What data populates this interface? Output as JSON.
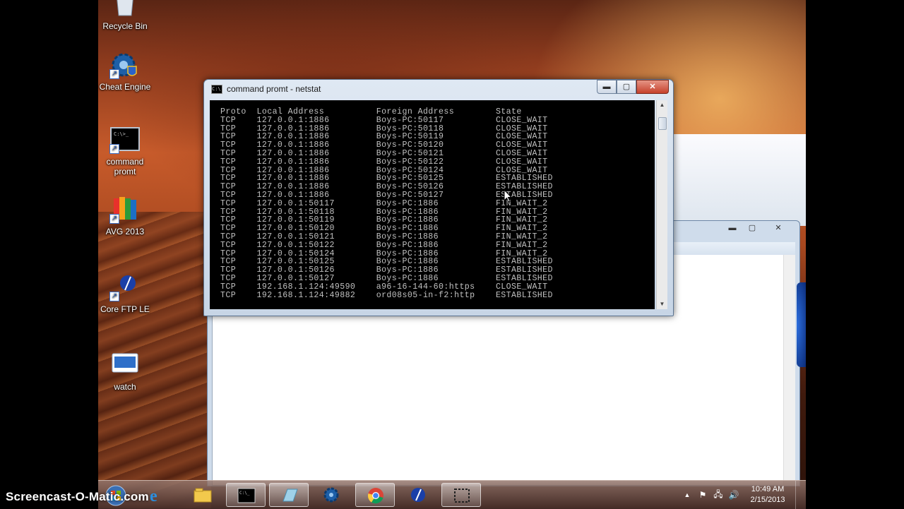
{
  "desktop": {
    "icons": [
      {
        "name": "Recycle Bin"
      },
      {
        "name": "Cheat Engine"
      },
      {
        "name": "command\npromt"
      },
      {
        "name": "AVG 2013"
      },
      {
        "name": "Core FTP LE"
      },
      {
        "name": "watch"
      }
    ]
  },
  "cmd_window": {
    "title": "command promt - netstat",
    "buttons": {
      "minimize": "▬",
      "maximize": "▢",
      "close": "✕"
    },
    "console_header": "Proto  Local Address          Foreign Address        State",
    "console_lines": [
      "TCP    127.0.0.1:1886         Boys-PC:50117          CLOSE_WAIT",
      "TCP    127.0.0.1:1886         Boys-PC:50118          CLOSE_WAIT",
      "TCP    127.0.0.1:1886         Boys-PC:50119          CLOSE_WAIT",
      "TCP    127.0.0.1:1886         Boys-PC:50120          CLOSE_WAIT",
      "TCP    127.0.0.1:1886         Boys-PC:50121          CLOSE_WAIT",
      "TCP    127.0.0.1:1886         Boys-PC:50122          CLOSE_WAIT",
      "TCP    127.0.0.1:1886         Boys-PC:50124          CLOSE_WAIT",
      "TCP    127.0.0.1:1886         Boys-PC:50125          ESTABLISHED",
      "TCP    127.0.0.1:1886         Boys-PC:50126          ESTABLISHED",
      "TCP    127.0.0.1:1886         Boys-PC:50127          ESTABLISHED",
      "TCP    127.0.0.1:50117        Boys-PC:1886           FIN_WAIT_2",
      "TCP    127.0.0.1:50118        Boys-PC:1886           FIN_WAIT_2",
      "TCP    127.0.0.1:50119        Boys-PC:1886           FIN_WAIT_2",
      "TCP    127.0.0.1:50120        Boys-PC:1886           FIN_WAIT_2",
      "TCP    127.0.0.1:50121        Boys-PC:1886           FIN_WAIT_2",
      "TCP    127.0.0.1:50122        Boys-PC:1886           FIN_WAIT_2",
      "TCP    127.0.0.1:50124        Boys-PC:1886           FIN_WAIT_2",
      "TCP    127.0.0.1:50125        Boys-PC:1886           ESTABLISHED",
      "TCP    127.0.0.1:50126        Boys-PC:1886           ESTABLISHED",
      "TCP    127.0.0.1:50127        Boys-PC:1886           ESTABLISHED",
      "TCP    192.168.1.124:49590    a96-16-144-60:https    CLOSE_WAIT",
      "TCP    192.168.1.124:49882    ord08s05-in-f2:http    ESTABLISHED"
    ]
  },
  "background_window": {
    "buttons": {
      "minimize": "▬",
      "maximize": "▢",
      "close": "✕"
    }
  },
  "taskbar": {
    "apps": [
      {
        "icon": "windows-start-icon"
      },
      {
        "icon": "internet-explorer-icon"
      },
      {
        "icon": "windows-explorer-icon"
      },
      {
        "icon": "command-prompt-icon"
      },
      {
        "icon": "notepad-icon"
      },
      {
        "icon": "cheat-engine-icon"
      },
      {
        "icon": "chrome-icon"
      },
      {
        "icon": "core-ftp-icon"
      },
      {
        "icon": "snipping-tool-icon"
      }
    ],
    "tray": {
      "expand": "▲",
      "flag": "⚑",
      "network": "🖧",
      "volume": "🔊"
    },
    "clock": {
      "time": "10:49 AM",
      "date": "2/15/2013"
    }
  },
  "watermark": "Screencast-O-Matic.com",
  "colors": {
    "console_bg": "#000000",
    "console_text": "#c0c0c0",
    "close_red": "#c6412c"
  }
}
